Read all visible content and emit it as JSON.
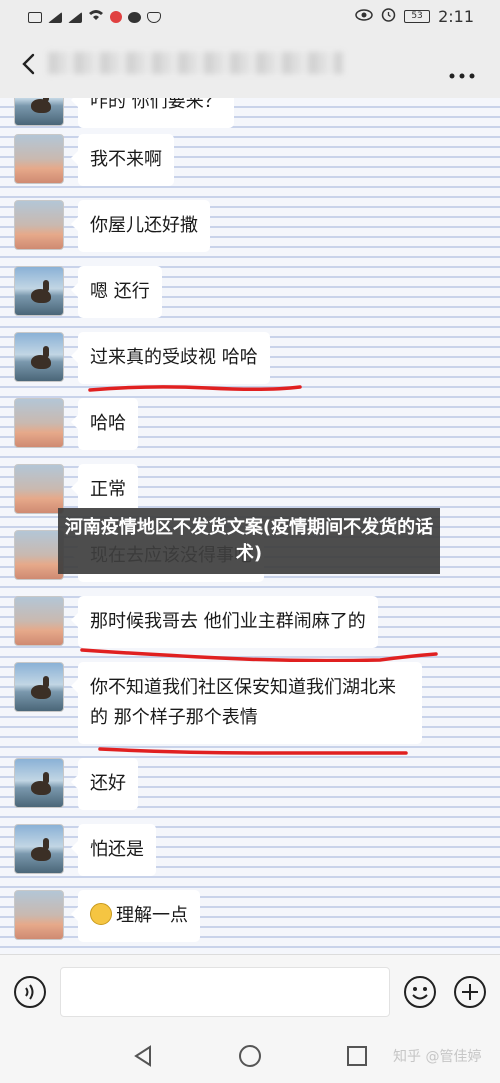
{
  "status": {
    "time": "2:11",
    "battery": "53",
    "left_icons": [
      "hd-icon",
      "signal-4g-icon",
      "signal-2g-icon",
      "wifi-icon",
      "app-notification-icon",
      "chat-notification-icon",
      "shield-icon"
    ],
    "right_icons": [
      "eye-icon",
      "alarm-icon",
      "battery-icon"
    ]
  },
  "header": {
    "title_obscured": true
  },
  "messages": [
    {
      "text": "咋的 你们要来？",
      "avatar": "lake"
    },
    {
      "text": "我不来啊",
      "avatar": "sunset"
    },
    {
      "text": "你屋儿还好撒",
      "avatar": "sunset"
    },
    {
      "text": "嗯 还行",
      "avatar": "lake"
    },
    {
      "text": "过来真的受歧视 哈哈",
      "avatar": "lake",
      "underlined": true
    },
    {
      "text": "哈哈",
      "avatar": "sunset"
    },
    {
      "text": "正常",
      "avatar": "sunset"
    },
    {
      "text": "现在去应该没得事吧",
      "avatar": "sunset"
    },
    {
      "text": "那时候我哥去 他们业主群闹麻了的",
      "avatar": "sunset",
      "underlined": true
    },
    {
      "text": "你不知道我们社区保安知道我们湖北来的 那个样子那个表情",
      "avatar": "lake",
      "underlined": true
    },
    {
      "text": "还好",
      "avatar": "lake"
    },
    {
      "text": "怕还是",
      "avatar": "lake"
    },
    {
      "text": "理解一点",
      "avatar": "sunset",
      "emoji": "grin-emoji"
    }
  ],
  "banner": {
    "text": "河南疫情地区不发货文案(疫情期间不发货的话术)"
  },
  "input": {
    "placeholder": ""
  },
  "watermark": {
    "text": "知乎 @管佳婷"
  },
  "colors": {
    "underline": "#e02020",
    "banner_bg": "#3e3e3e",
    "chat_bg": "#f4f6fb",
    "chat_lines": "#c9d3ea"
  }
}
